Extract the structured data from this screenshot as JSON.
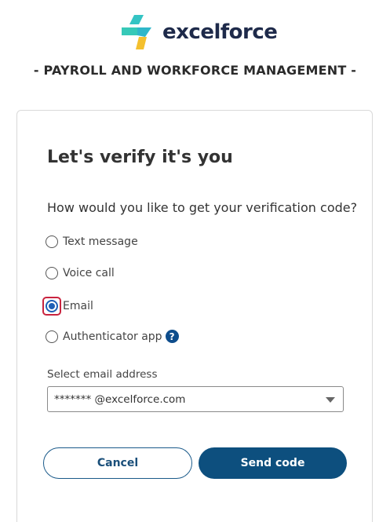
{
  "brand": {
    "name": "excelforce",
    "tagline": "- PAYROLL AND WORKFORCE MANAGEMENT -",
    "colors": {
      "teal": "#34c4c4",
      "yellow": "#f4c02e",
      "navy": "#1e2a4a"
    }
  },
  "card": {
    "title": "Let's verify it's you",
    "question": "How would you like to get your verification code?",
    "options": [
      {
        "label": "Text message",
        "selected": false
      },
      {
        "label": "Voice call",
        "selected": false
      },
      {
        "label": "Email",
        "selected": true
      },
      {
        "label": "Authenticator app",
        "selected": false,
        "help_icon": "question-icon",
        "help_glyph": "?"
      }
    ],
    "select": {
      "label": "Select email address",
      "value": "*******  @excelforce.com"
    },
    "buttons": {
      "cancel": "Cancel",
      "send": "Send code"
    }
  }
}
